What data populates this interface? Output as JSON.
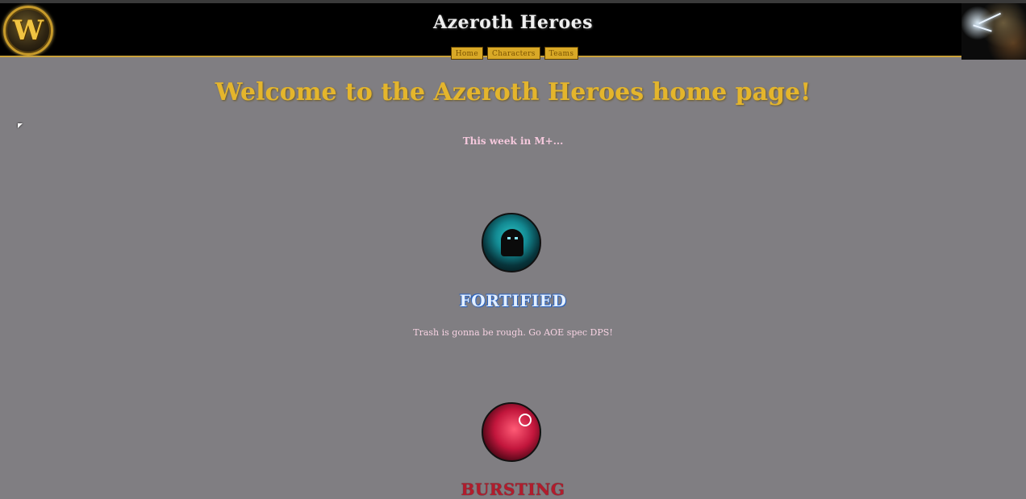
{
  "header": {
    "logo_letter": "W",
    "title": "Azeroth Heroes",
    "nav": [
      "Home",
      "Characters",
      "Teams"
    ]
  },
  "main": {
    "welcome": "Welcome to the Azeroth Heroes home page!",
    "week_heading": "This week in M+...",
    "affixes": [
      {
        "name": "FORTIFIED",
        "description": "Trash is gonna be rough. Go AOE spec DPS!",
        "icon": "shadow-figure-icon",
        "color": "#2ec6c6"
      },
      {
        "name": "BURSTING",
        "icon": "skull-burst-icon",
        "color": "#c2163c"
      }
    ]
  },
  "colors": {
    "page_bg": "#807e82",
    "header_bg": "#000000",
    "accent_gold": "#e4b52c",
    "nav_button": "#d9a927"
  }
}
